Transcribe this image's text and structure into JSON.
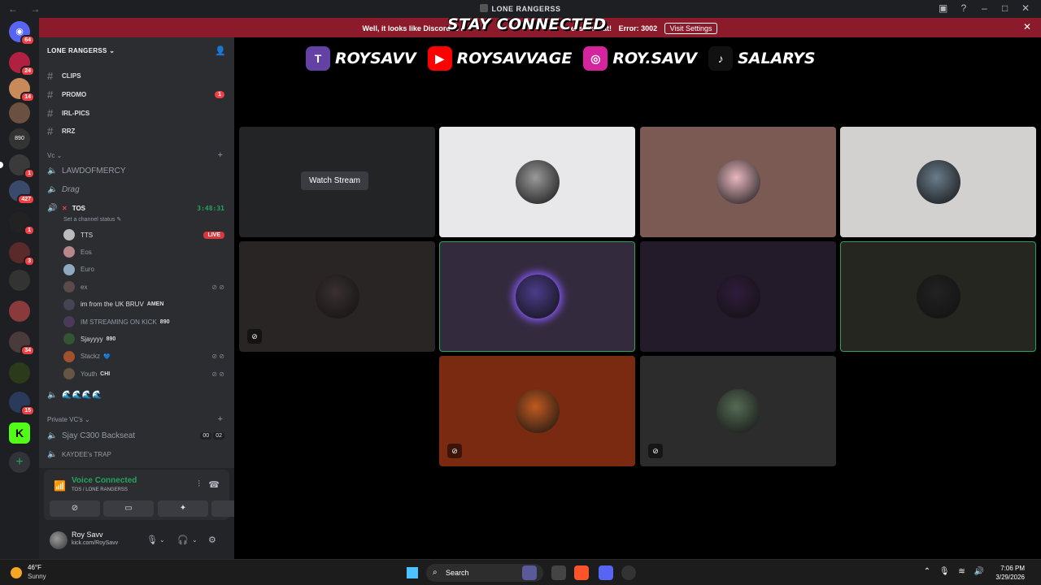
{
  "window": {
    "title": "LONE RANGERSS",
    "nav_back": "←",
    "nav_fwd": "→"
  },
  "banner": {
    "message": "Well, it looks like Discord is n",
    "message_tail": "et's fix that!",
    "error": "Error: 3002",
    "action": "Visit Settings"
  },
  "overlay": {
    "title": "STAY CONNECTED",
    "socials": [
      {
        "platform": "twitch-icon",
        "handle": "ROYSAVV",
        "color": "#6441a5"
      },
      {
        "platform": "youtube-icon",
        "handle": "ROYSAVVAGE",
        "color": "#ff0000"
      },
      {
        "platform": "instagram-icon",
        "handle": "ROY.SAVV",
        "color": "#d6249f"
      },
      {
        "platform": "tiktok-icon",
        "handle": "SALARYS",
        "color": "#111111"
      }
    ]
  },
  "guilds": {
    "home_badge": "64",
    "badges": [
      "24",
      "14",
      "1",
      "427",
      "1",
      "3",
      "34",
      "15"
    ]
  },
  "sidebar": {
    "server_name": "LONE RANGERSS",
    "text_channels": [
      {
        "name": "CLIPS",
        "badge": ""
      },
      {
        "name": "PROMO",
        "badge": "1"
      },
      {
        "name": "IRL-PICS",
        "badge": ""
      },
      {
        "name": "RRZ",
        "badge": ""
      }
    ],
    "vc_category": "Vc",
    "voice_channels": [
      {
        "name": "LAWDOFMERCY"
      },
      {
        "name": "Drag"
      }
    ],
    "active_channel": {
      "name": "TOS",
      "timer": "3:48:31",
      "status": "Set a channel status"
    },
    "members": [
      {
        "name": "TTS",
        "tag": "",
        "live": "LIVE",
        "bright": true,
        "color": "#bbb"
      },
      {
        "name": "Eos",
        "tag": "",
        "bright": false,
        "color": "#b8868b"
      },
      {
        "name": "Euro",
        "tag": "",
        "bright": false,
        "color": "#8fa9c0"
      },
      {
        "name": "ex",
        "tag": "",
        "bright": false,
        "color": "#5a4a4a"
      },
      {
        "name": "im from the UK BRUV",
        "tag": "AMEN",
        "bright": true,
        "color": "#445"
      },
      {
        "name": "IM STREAMING ON KICK",
        "tag": "890",
        "bright": false,
        "color": "#4a3a5a"
      },
      {
        "name": "Sjayyyy",
        "tag": "890",
        "bright": true,
        "color": "#335533"
      },
      {
        "name": "Stackz",
        "tag": "💙",
        "bright": false,
        "color": "#a0522d"
      },
      {
        "name": "Youth",
        "tag": "CHI",
        "bright": false,
        "color": "#665544"
      }
    ],
    "waves_channel": "🌊🌊🌊🌊",
    "private_category": "Private VC's",
    "private_channels": [
      {
        "name": "Sjay C300 Backseat",
        "time_a": "00",
        "time_b": "02"
      },
      {
        "name": "KAYDEE's TRAP"
      }
    ]
  },
  "voice_panel": {
    "title": "Voice Connected",
    "subtitle": "TOS / LONE RANGERSS"
  },
  "user": {
    "name": "Roy Savv",
    "status": "kick.com/RoySavv"
  },
  "stage": {
    "watch_label": "Watch Stream",
    "tiles": [
      {
        "bg": "#222426",
        "avatar": "",
        "stream": true
      },
      {
        "bg": "#e8e8ea",
        "avatar": "#9a9a9a"
      },
      {
        "bg": "#7b5a54",
        "avatar": "#e8b8c0"
      },
      {
        "bg": "#d2d1cf",
        "avatar": "#6a7c8a"
      },
      {
        "bg": "#2a2525",
        "avatar": "#3a3030",
        "camoff": true
      },
      {
        "bg": "#342a3e",
        "avatar": "#4b3c8a",
        "speaking": true
      },
      {
        "bg": "#231a2a",
        "avatar": "#301c3c"
      },
      {
        "bg": "#24261f",
        "avatar": "#222",
        "speaking": true
      },
      {
        "bg": "#7a2a10",
        "avatar": "#c05a20",
        "camoff": true
      },
      {
        "bg": "#2c2c2c",
        "avatar": "#556b55",
        "camoff": true
      }
    ]
  },
  "taskbar": {
    "temp": "46°F",
    "condition": "Sunny",
    "search": "Search",
    "time": "7:06 PM",
    "date": "3/29/2026"
  }
}
